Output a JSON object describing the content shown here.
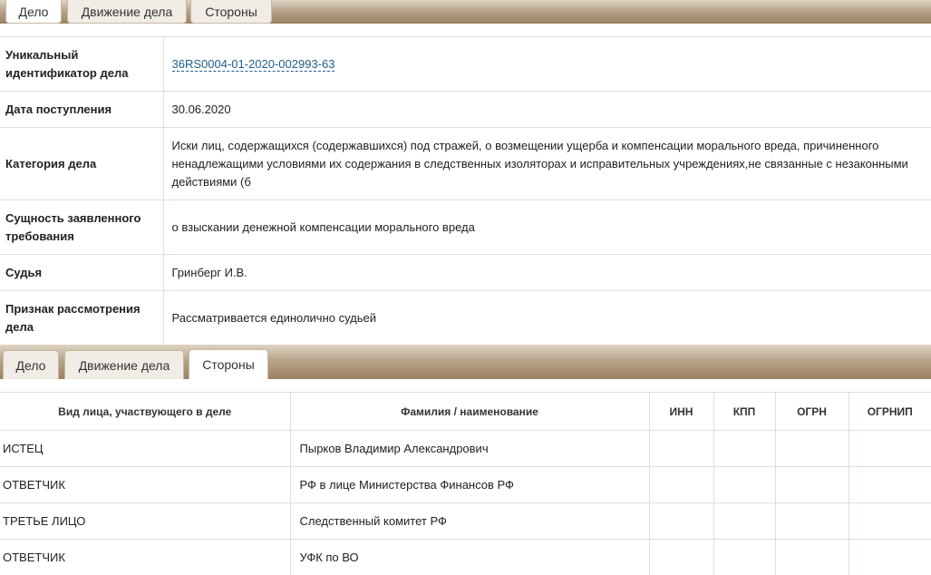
{
  "tabs": [
    "Дело",
    "Движение дела",
    "Стороны"
  ],
  "case": {
    "uid_label": "Уникальный идентификатор дела",
    "uid_value": "36RS0004-01-2020-002993-63",
    "date_label": "Дата поступления",
    "date_value": "30.06.2020",
    "category_label": "Категория дела",
    "category_value": "Иски лиц, содержащихся (содержавшихся) под стражей, о возмещении ущерба и компенсации морального вреда, причиненного ненадлежащими условиями их содержания в следственных изоляторах и исправительных учреждениях,не связанные с незаконными действиями (б",
    "essence_label": "Сущность заявленного требования",
    "essence_value": "о взыскании денежной компенсации морального вреда",
    "judge_label": "Судья",
    "judge_value": "Гринберг И.В.",
    "consider_label": "Признак рассмотрения дела",
    "consider_value": "Рассматривается единолично судьей"
  },
  "parties": {
    "headers": [
      "Вид лица, участвующего в деле",
      "Фамилия / наименование",
      "ИНН",
      "КПП",
      "ОГРН",
      "ОГРНИП"
    ],
    "rows": [
      [
        "ИСТЕЦ",
        "Пырков Владимир Александрович"
      ],
      [
        "ОТВЕТЧИК",
        "РФ в лице Министерства Финансов РФ"
      ],
      [
        "ТРЕТЬЕ ЛИЦО",
        "Следственный комитет РФ"
      ],
      [
        "ОТВЕТЧИК",
        "УФК по ВО"
      ]
    ]
  }
}
